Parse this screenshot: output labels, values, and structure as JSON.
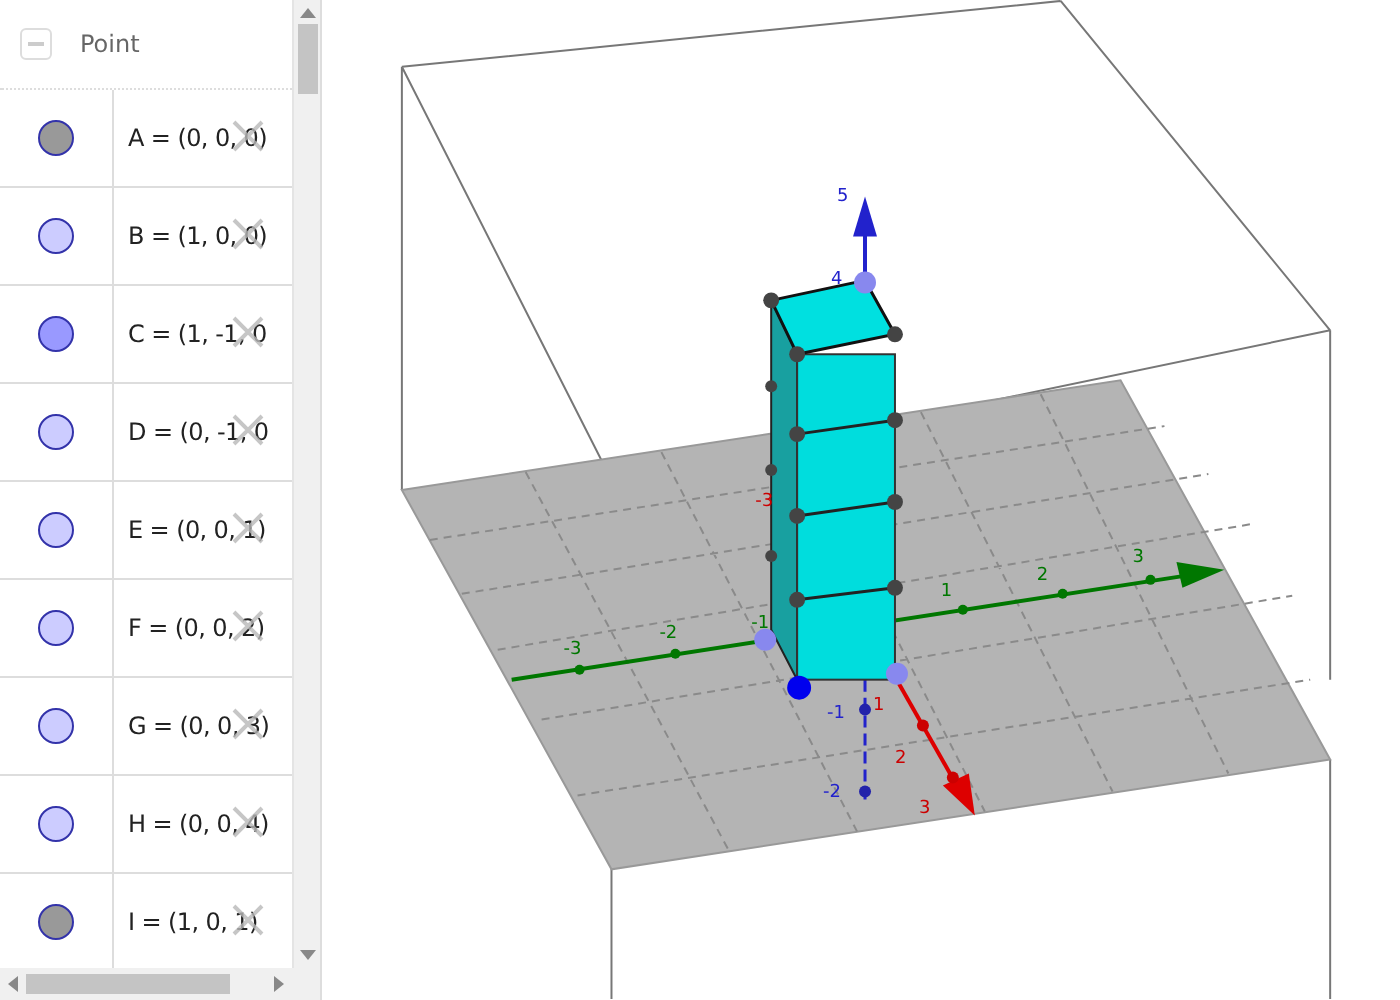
{
  "algebra": {
    "heading": "Point",
    "collapsed": false,
    "items": [
      {
        "text": "A = (0, 0, 0)",
        "color": "#999999"
      },
      {
        "text": "B = (1, 0, 0)",
        "color": "#ccccff"
      },
      {
        "text": "C = (1, -1, 0",
        "color": "#9999ff"
      },
      {
        "text": "D = (0, -1, 0",
        "color": "#ccccff"
      },
      {
        "text": "E = (0, 0, 1)",
        "color": "#ccccff"
      },
      {
        "text": "F = (0, 0, 2)",
        "color": "#ccccff"
      },
      {
        "text": "G = (0, 0, 3)",
        "color": "#ccccff"
      },
      {
        "text": "H = (0, 0, 4)",
        "color": "#ccccff"
      },
      {
        "text": "I = (1, 0, 1)",
        "color": "#999999"
      }
    ]
  },
  "view3d": {
    "axis_labels": [
      {
        "text": "5",
        "color": "#2222cc"
      },
      {
        "text": "4",
        "color": "#2222cc"
      },
      {
        "text": "-3",
        "color": "#007700"
      },
      {
        "text": "-2",
        "color": "#007700"
      },
      {
        "text": "-1",
        "color": "#007700"
      },
      {
        "text": "1",
        "color": "#007700"
      },
      {
        "text": "2",
        "color": "#007700"
      },
      {
        "text": "3",
        "color": "#007700"
      },
      {
        "text": "-3",
        "color": "#cc0000"
      },
      {
        "text": "1",
        "color": "#cc0000"
      },
      {
        "text": "2",
        "color": "#cc0000"
      },
      {
        "text": "3",
        "color": "#cc0000"
      },
      {
        "text": "-1",
        "color": "#2222cc"
      },
      {
        "text": "-2",
        "color": "#2222cc"
      }
    ]
  }
}
